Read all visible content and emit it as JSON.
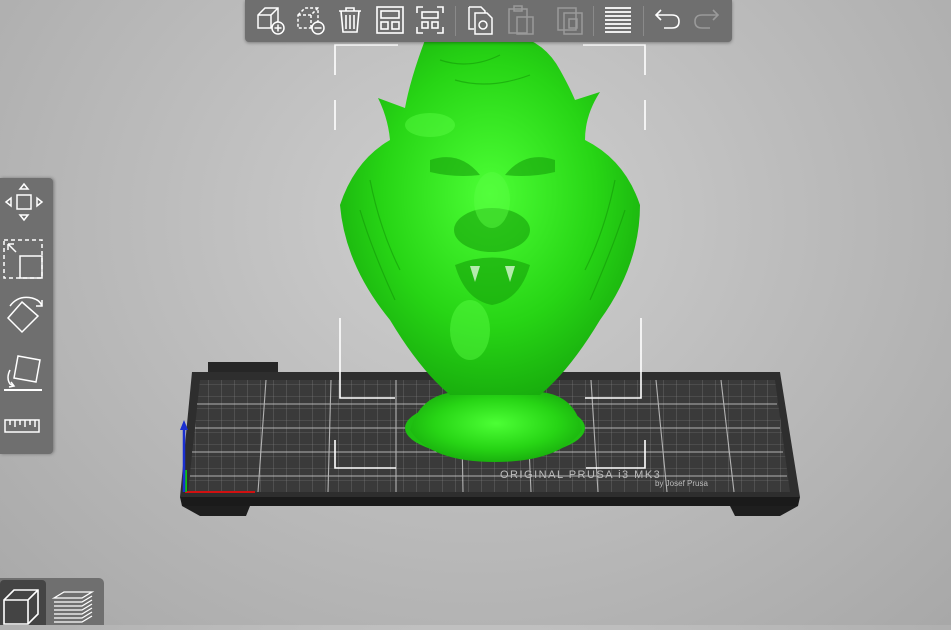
{
  "app": {
    "title": ""
  },
  "top_toolbar": {
    "buttons": [
      {
        "name": "add",
        "icon": "add-cube-icon",
        "enabled": true
      },
      {
        "name": "delete",
        "icon": "delete-cube-icon",
        "enabled": true
      },
      {
        "name": "delete-all",
        "icon": "trash-icon",
        "enabled": true
      },
      {
        "name": "arrange",
        "icon": "arrange-icon",
        "enabled": true
      },
      {
        "name": "arrange-selection",
        "icon": "arrange-selection-icon",
        "enabled": true
      },
      {
        "name": "copy",
        "icon": "copy-icon",
        "enabled": true
      },
      {
        "name": "paste",
        "icon": "paste-icon",
        "enabled": false
      },
      {
        "name": "instance",
        "icon": "instance-icon",
        "enabled": false
      },
      {
        "name": "layers-editing",
        "icon": "layers-editing-icon",
        "enabled": true
      },
      {
        "name": "undo",
        "icon": "undo-icon",
        "enabled": true
      },
      {
        "name": "redo",
        "icon": "redo-icon",
        "enabled": false
      }
    ]
  },
  "left_toolbar": {
    "tools": [
      {
        "name": "move",
        "icon": "move-arrows-icon"
      },
      {
        "name": "scale",
        "icon": "scale-icon"
      },
      {
        "name": "rotate",
        "icon": "rotate-icon"
      },
      {
        "name": "place-on-face",
        "icon": "place-on-face-icon"
      },
      {
        "name": "measure",
        "icon": "ruler-icon"
      }
    ]
  },
  "view_switch": {
    "active": "3d-view",
    "buttons": [
      {
        "name": "3d-view",
        "icon": "cube-view-icon"
      },
      {
        "name": "preview",
        "icon": "layers-preview-icon"
      }
    ]
  },
  "bed": {
    "label_line1": "ORIGINAL PRUSA i3 MK3",
    "label_line2": "by Josef Prusa"
  },
  "colors": {
    "toolbar_bg": "#6f6f6f",
    "model": "#2ed91a",
    "bed": "#2c2c2c",
    "grid": "#9a9a9a",
    "axis_x": "#d01010",
    "axis_y": "#10c010",
    "axis_z": "#1a2fd0"
  }
}
